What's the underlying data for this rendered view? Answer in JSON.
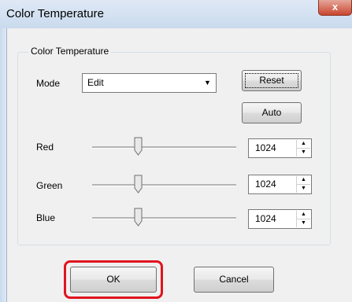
{
  "window": {
    "title": "Color Temperature",
    "close_label": "x"
  },
  "group": {
    "caption": "Color Temperature"
  },
  "mode": {
    "label": "Mode",
    "selected": "Edit",
    "arrow": "▼"
  },
  "buttons": {
    "reset": "Reset",
    "auto": "Auto",
    "ok": "OK",
    "cancel": "Cancel"
  },
  "channels": [
    {
      "label": "Red",
      "value": "1024",
      "slider_fraction": 0.32
    },
    {
      "label": "Green",
      "value": "1024",
      "slider_fraction": 0.32
    },
    {
      "label": "Blue",
      "value": "1024",
      "slider_fraction": 0.32
    }
  ],
  "spin": {
    "up": "▲",
    "down": "▼"
  },
  "colors": {
    "highlight": "#e0141e"
  },
  "icons": {
    "close": "close-icon",
    "dropdown": "chevron-down-icon",
    "spin_up": "arrow-up-icon",
    "spin_down": "arrow-down-icon"
  }
}
